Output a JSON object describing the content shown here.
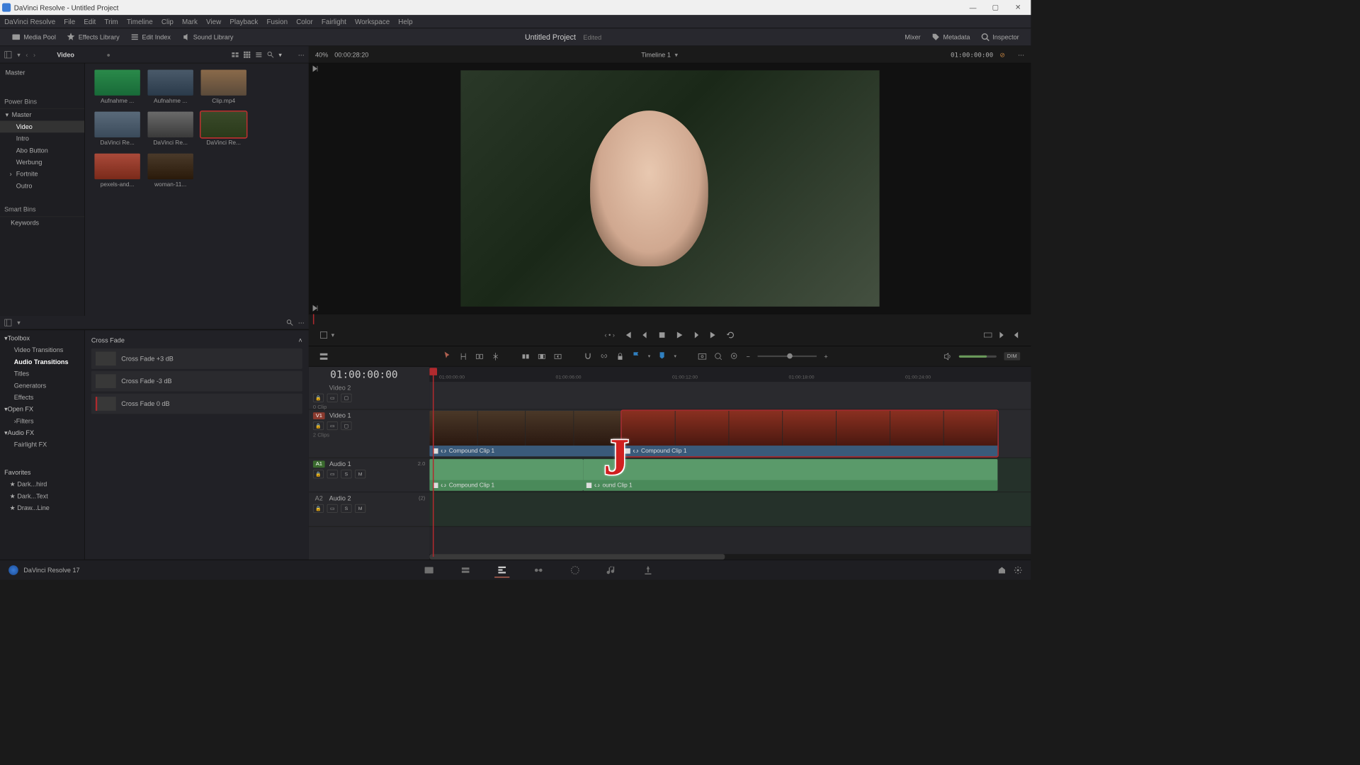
{
  "titlebar": {
    "text": "DaVinci Resolve - Untitled Project"
  },
  "menu": [
    "DaVinci Resolve",
    "File",
    "Edit",
    "Trim",
    "Timeline",
    "Clip",
    "Mark",
    "View",
    "Playback",
    "Fusion",
    "Color",
    "Fairlight",
    "Workspace",
    "Help"
  ],
  "toolbar": {
    "media_pool": "Media Pool",
    "effects_library": "Effects Library",
    "edit_index": "Edit Index",
    "sound_library": "Sound Library",
    "project": "Untitled Project",
    "edited": "Edited",
    "mixer": "Mixer",
    "metadata": "Metadata",
    "inspector": "Inspector"
  },
  "media_header": {
    "bin": "Video",
    "zoom_pct": "40%",
    "duration": "00:00:28:20",
    "timeline_name": "Timeline 1",
    "timecode_right": "01:00:00:00"
  },
  "media_tree": {
    "master": "Master",
    "power_bins": "Power Bins",
    "pb_master": "Master",
    "items": [
      "Video",
      "Intro",
      "Abo Button",
      "Werbung",
      "Fortnite",
      "Outro"
    ],
    "smart_bins": "Smart Bins",
    "keywords": "Keywords"
  },
  "thumbs": [
    "Aufnahme ...",
    "Aufnahme ...",
    "Clip.mp4",
    "DaVinci Re...",
    "DaVinci Re...",
    "DaVinci Re...",
    "pexels-and...",
    "woman-11..."
  ],
  "effects_tree": {
    "toolbox": "Toolbox",
    "items": [
      "Video Transitions",
      "Audio Transitions",
      "Titles",
      "Generators",
      "Effects"
    ],
    "open_fx": "Open FX",
    "filters": "Filters",
    "audio_fx": "Audio FX",
    "fairlight_fx": "Fairlight FX",
    "favorites": "Favorites",
    "fav_items": [
      "Dark...hird",
      "Dark...Text",
      "Draw...Line"
    ]
  },
  "effects_list": {
    "group": "Cross Fade",
    "items": [
      "Cross Fade +3 dB",
      "Cross Fade -3 dB",
      "Cross Fade 0 dB"
    ]
  },
  "timeline": {
    "timecode": "01:00:00:00",
    "ruler_ticks": [
      "01:00:00:00",
      "01:00:06:00",
      "01:00:12:00",
      "01:00:18:00",
      "01:00:24:00"
    ],
    "video2_label": "Video 2",
    "video1_badge": "V1",
    "video1_label": "Video 1",
    "video1_clips": "2 Clips",
    "audio1_badge": "A1",
    "audio1_label": "Audio 1",
    "audio1_ch": "2.0",
    "audio2_badge": "A2",
    "audio2_label": "Audio 2",
    "audio2_ch": "(2)",
    "clip1_name": "Compound Clip 1",
    "clip2_name": "Compound Clip 1",
    "aclip1_name": "Compound Clip 1",
    "aclip2_name": "ound Clip 1",
    "zero_clip": "0 Clip"
  },
  "bottom": {
    "version": "DaVinci Resolve 17"
  },
  "j_letter": "J",
  "solo": "S",
  "mute": "M",
  "dim": "DIM"
}
